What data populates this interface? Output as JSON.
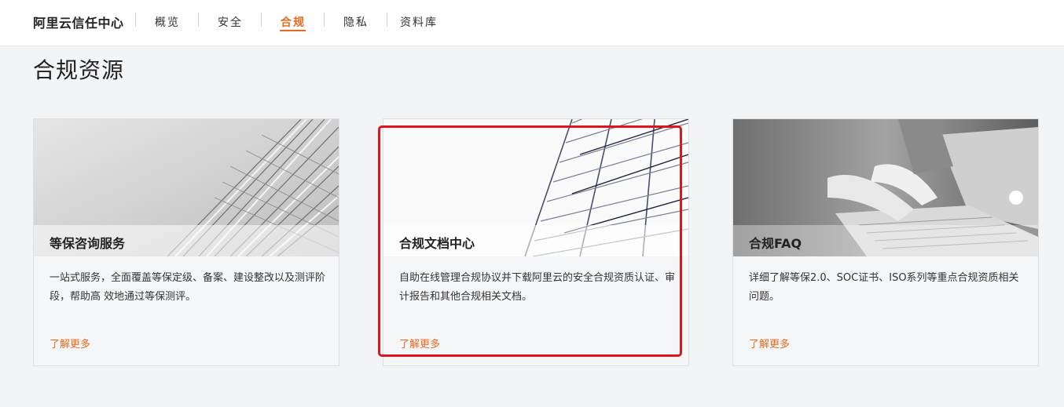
{
  "nav": {
    "brand": "阿里云信任中心",
    "items": [
      {
        "label": "概览",
        "active": false
      },
      {
        "label": "安全",
        "active": false
      },
      {
        "label": "合规",
        "active": true
      },
      {
        "label": "隐私",
        "active": false
      },
      {
        "label": "资料库",
        "active": false
      }
    ]
  },
  "main": {
    "section_title": "合规资源",
    "cards": [
      {
        "title": "等保咨询服务",
        "desc": "一站式服务，全面覆盖等保定级、备案、建设整改以及测评阶段，帮助高 效地通过等保测评。",
        "link": "了解更多",
        "image": "building-facade-image"
      },
      {
        "title": "合规文档中心",
        "desc": "自助在线管理合规协议并下载阿里云的安全合规资质认证、审计报告和其他合规相关文档。",
        "link": "了解更多",
        "image": "glass-building-image"
      },
      {
        "title": "合规FAQ",
        "desc": "详细了解等保2.0、SOC证书、ISO系列等重点合规资质相关问题。",
        "link": "了解更多",
        "image": "laptop-typing-image"
      }
    ]
  },
  "colors": {
    "accent": "#e86a1f",
    "highlight": "#e0141b"
  }
}
